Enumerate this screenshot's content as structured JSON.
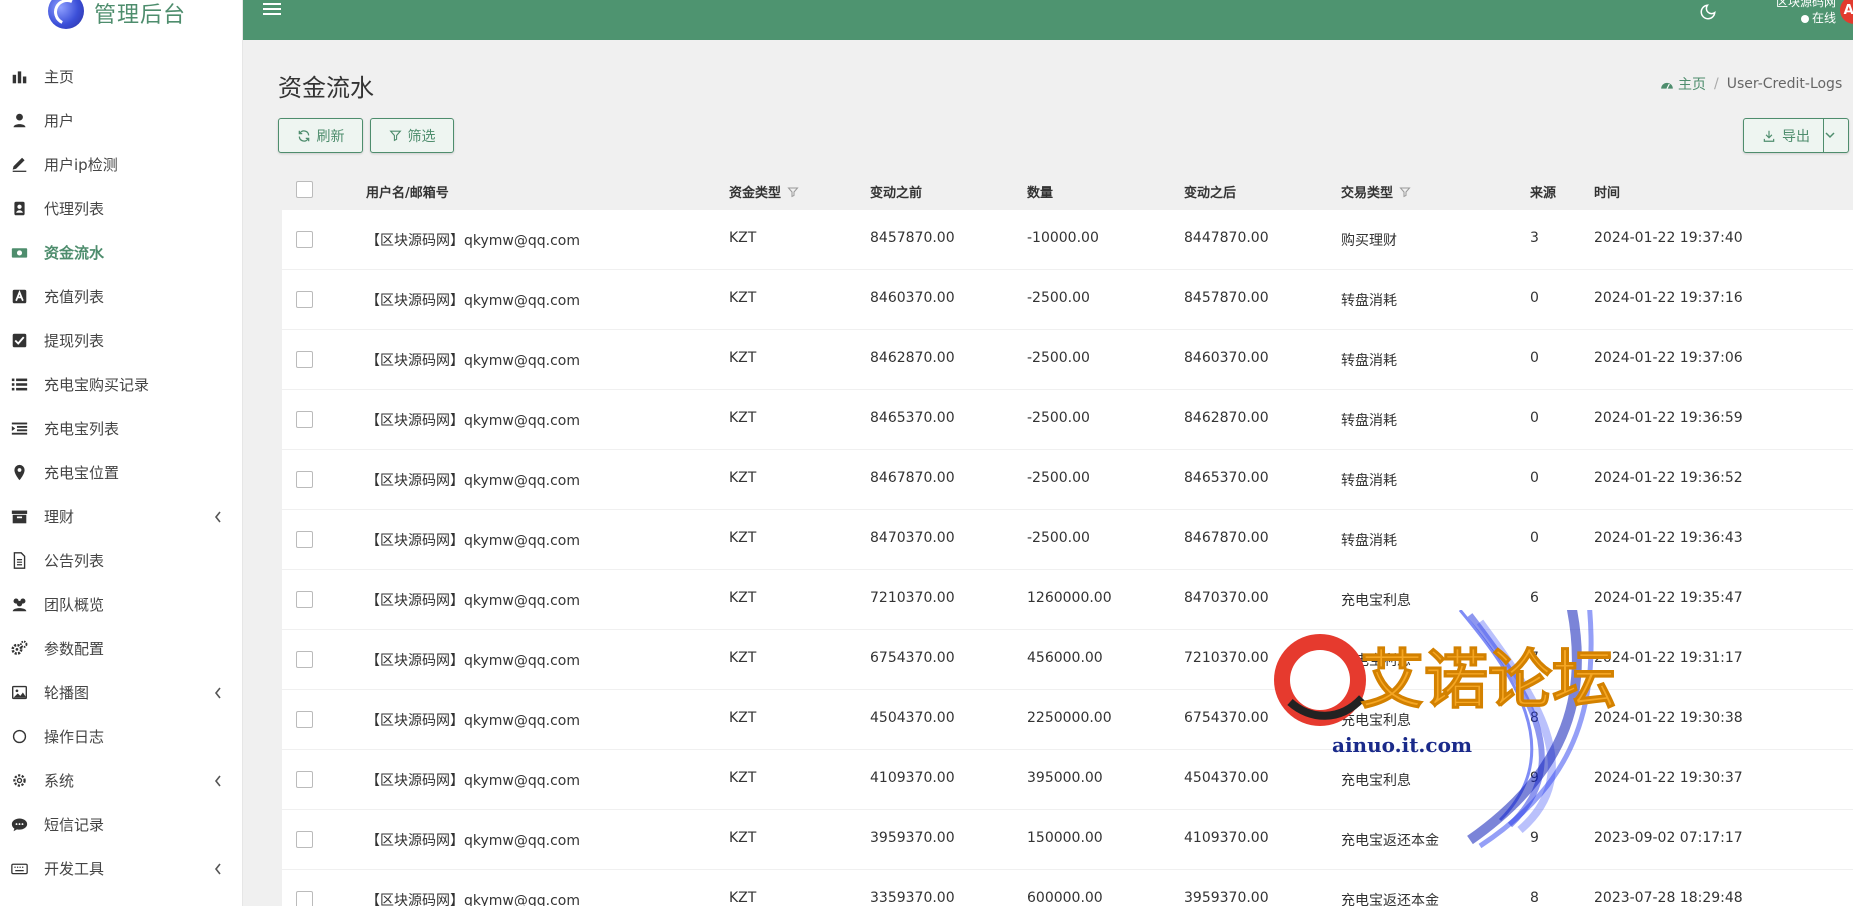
{
  "brand": {
    "title": "管理后台"
  },
  "sidebar": {
    "items": [
      {
        "label": "主页",
        "icon": "bar-chart-icon"
      },
      {
        "label": "用户",
        "icon": "user-icon"
      },
      {
        "label": "用户ip检测",
        "icon": "pen-icon"
      },
      {
        "label": "代理列表",
        "icon": "address-book-icon"
      },
      {
        "label": "资金流水",
        "icon": "money-icon",
        "active": true
      },
      {
        "label": "充值列表",
        "icon": "font-icon"
      },
      {
        "label": "提现列表",
        "icon": "check-square-icon"
      },
      {
        "label": "充电宝购买记录",
        "icon": "list-icon"
      },
      {
        "label": "充电宝列表",
        "icon": "indent-icon"
      },
      {
        "label": "充电宝位置",
        "icon": "map-marker-icon"
      },
      {
        "label": "理财",
        "icon": "archive-icon",
        "expandable": true
      },
      {
        "label": "公告列表",
        "icon": "file-text-icon"
      },
      {
        "label": "团队概览",
        "icon": "users-icon"
      },
      {
        "label": "参数配置",
        "icon": "cogs-icon"
      },
      {
        "label": "轮播图",
        "icon": "image-icon",
        "expandable": true
      },
      {
        "label": "操作日志",
        "icon": "circle-icon"
      },
      {
        "label": "系统",
        "icon": "gear-icon",
        "expandable": true
      },
      {
        "label": "短信记录",
        "icon": "comment-icon"
      },
      {
        "label": "开发工具",
        "icon": "keyboard-icon",
        "expandable": true
      }
    ]
  },
  "header": {
    "user_name": "区块源码网",
    "status": "在线",
    "avatar_text": "AD"
  },
  "page": {
    "title": "资金流水",
    "breadcrumb_home": "主页",
    "breadcrumb_current": "User-Credit-Logs"
  },
  "toolbar": {
    "refresh_label": "刷新",
    "filter_label": "筛选",
    "export_label": "导出"
  },
  "table": {
    "columns": [
      "用户名/邮箱号",
      "资金类型",
      "变动之前",
      "数量",
      "变动之后",
      "交易类型",
      "来源",
      "时间"
    ],
    "rows": [
      [
        "【区块源码网】qkymw@qq.com",
        "KZT",
        "8457870.00",
        "-10000.00",
        "8447870.00",
        "购买理财",
        "3",
        "2024-01-22 19:37:40"
      ],
      [
        "【区块源码网】qkymw@qq.com",
        "KZT",
        "8460370.00",
        "-2500.00",
        "8457870.00",
        "转盘消耗",
        "0",
        "2024-01-22 19:37:16"
      ],
      [
        "【区块源码网】qkymw@qq.com",
        "KZT",
        "8462870.00",
        "-2500.00",
        "8460370.00",
        "转盘消耗",
        "0",
        "2024-01-22 19:37:06"
      ],
      [
        "【区块源码网】qkymw@qq.com",
        "KZT",
        "8465370.00",
        "-2500.00",
        "8462870.00",
        "转盘消耗",
        "0",
        "2024-01-22 19:36:59"
      ],
      [
        "【区块源码网】qkymw@qq.com",
        "KZT",
        "8467870.00",
        "-2500.00",
        "8465370.00",
        "转盘消耗",
        "0",
        "2024-01-22 19:36:52"
      ],
      [
        "【区块源码网】qkymw@qq.com",
        "KZT",
        "8470370.00",
        "-2500.00",
        "8467870.00",
        "转盘消耗",
        "0",
        "2024-01-22 19:36:43"
      ],
      [
        "【区块源码网】qkymw@qq.com",
        "KZT",
        "7210370.00",
        "1260000.00",
        "8470370.00",
        "充电宝利息",
        "6",
        "2024-01-22 19:35:47"
      ],
      [
        "【区块源码网】qkymw@qq.com",
        "KZT",
        "6754370.00",
        "456000.00",
        "7210370.00",
        "充电宝利息",
        "7",
        "2024-01-22 19:31:17"
      ],
      [
        "【区块源码网】qkymw@qq.com",
        "KZT",
        "4504370.00",
        "2250000.00",
        "6754370.00",
        "充电宝利息",
        "8",
        "2024-01-22 19:30:38"
      ],
      [
        "【区块源码网】qkymw@qq.com",
        "KZT",
        "4109370.00",
        "395000.00",
        "4504370.00",
        "充电宝利息",
        "9",
        "2024-01-22 19:30:37"
      ],
      [
        "【区块源码网】qkymw@qq.com",
        "KZT",
        "3959370.00",
        "150000.00",
        "4109370.00",
        "充电宝返还本金",
        "9",
        "2023-09-02 07:17:17"
      ],
      [
        "【区块源码网】qkymw@qq.com",
        "KZT",
        "3359370.00",
        "600000.00",
        "3959370.00",
        "充电宝返还本金",
        "8",
        "2023-07-28 18:29:48"
      ]
    ]
  },
  "watermark": {
    "title": "艾诺论坛",
    "url": "ainuo.it.com"
  },
  "colors": {
    "primary": "#4e9470",
    "active_text": "#4e8d6d",
    "avatar_bg": "#e23b2e"
  }
}
